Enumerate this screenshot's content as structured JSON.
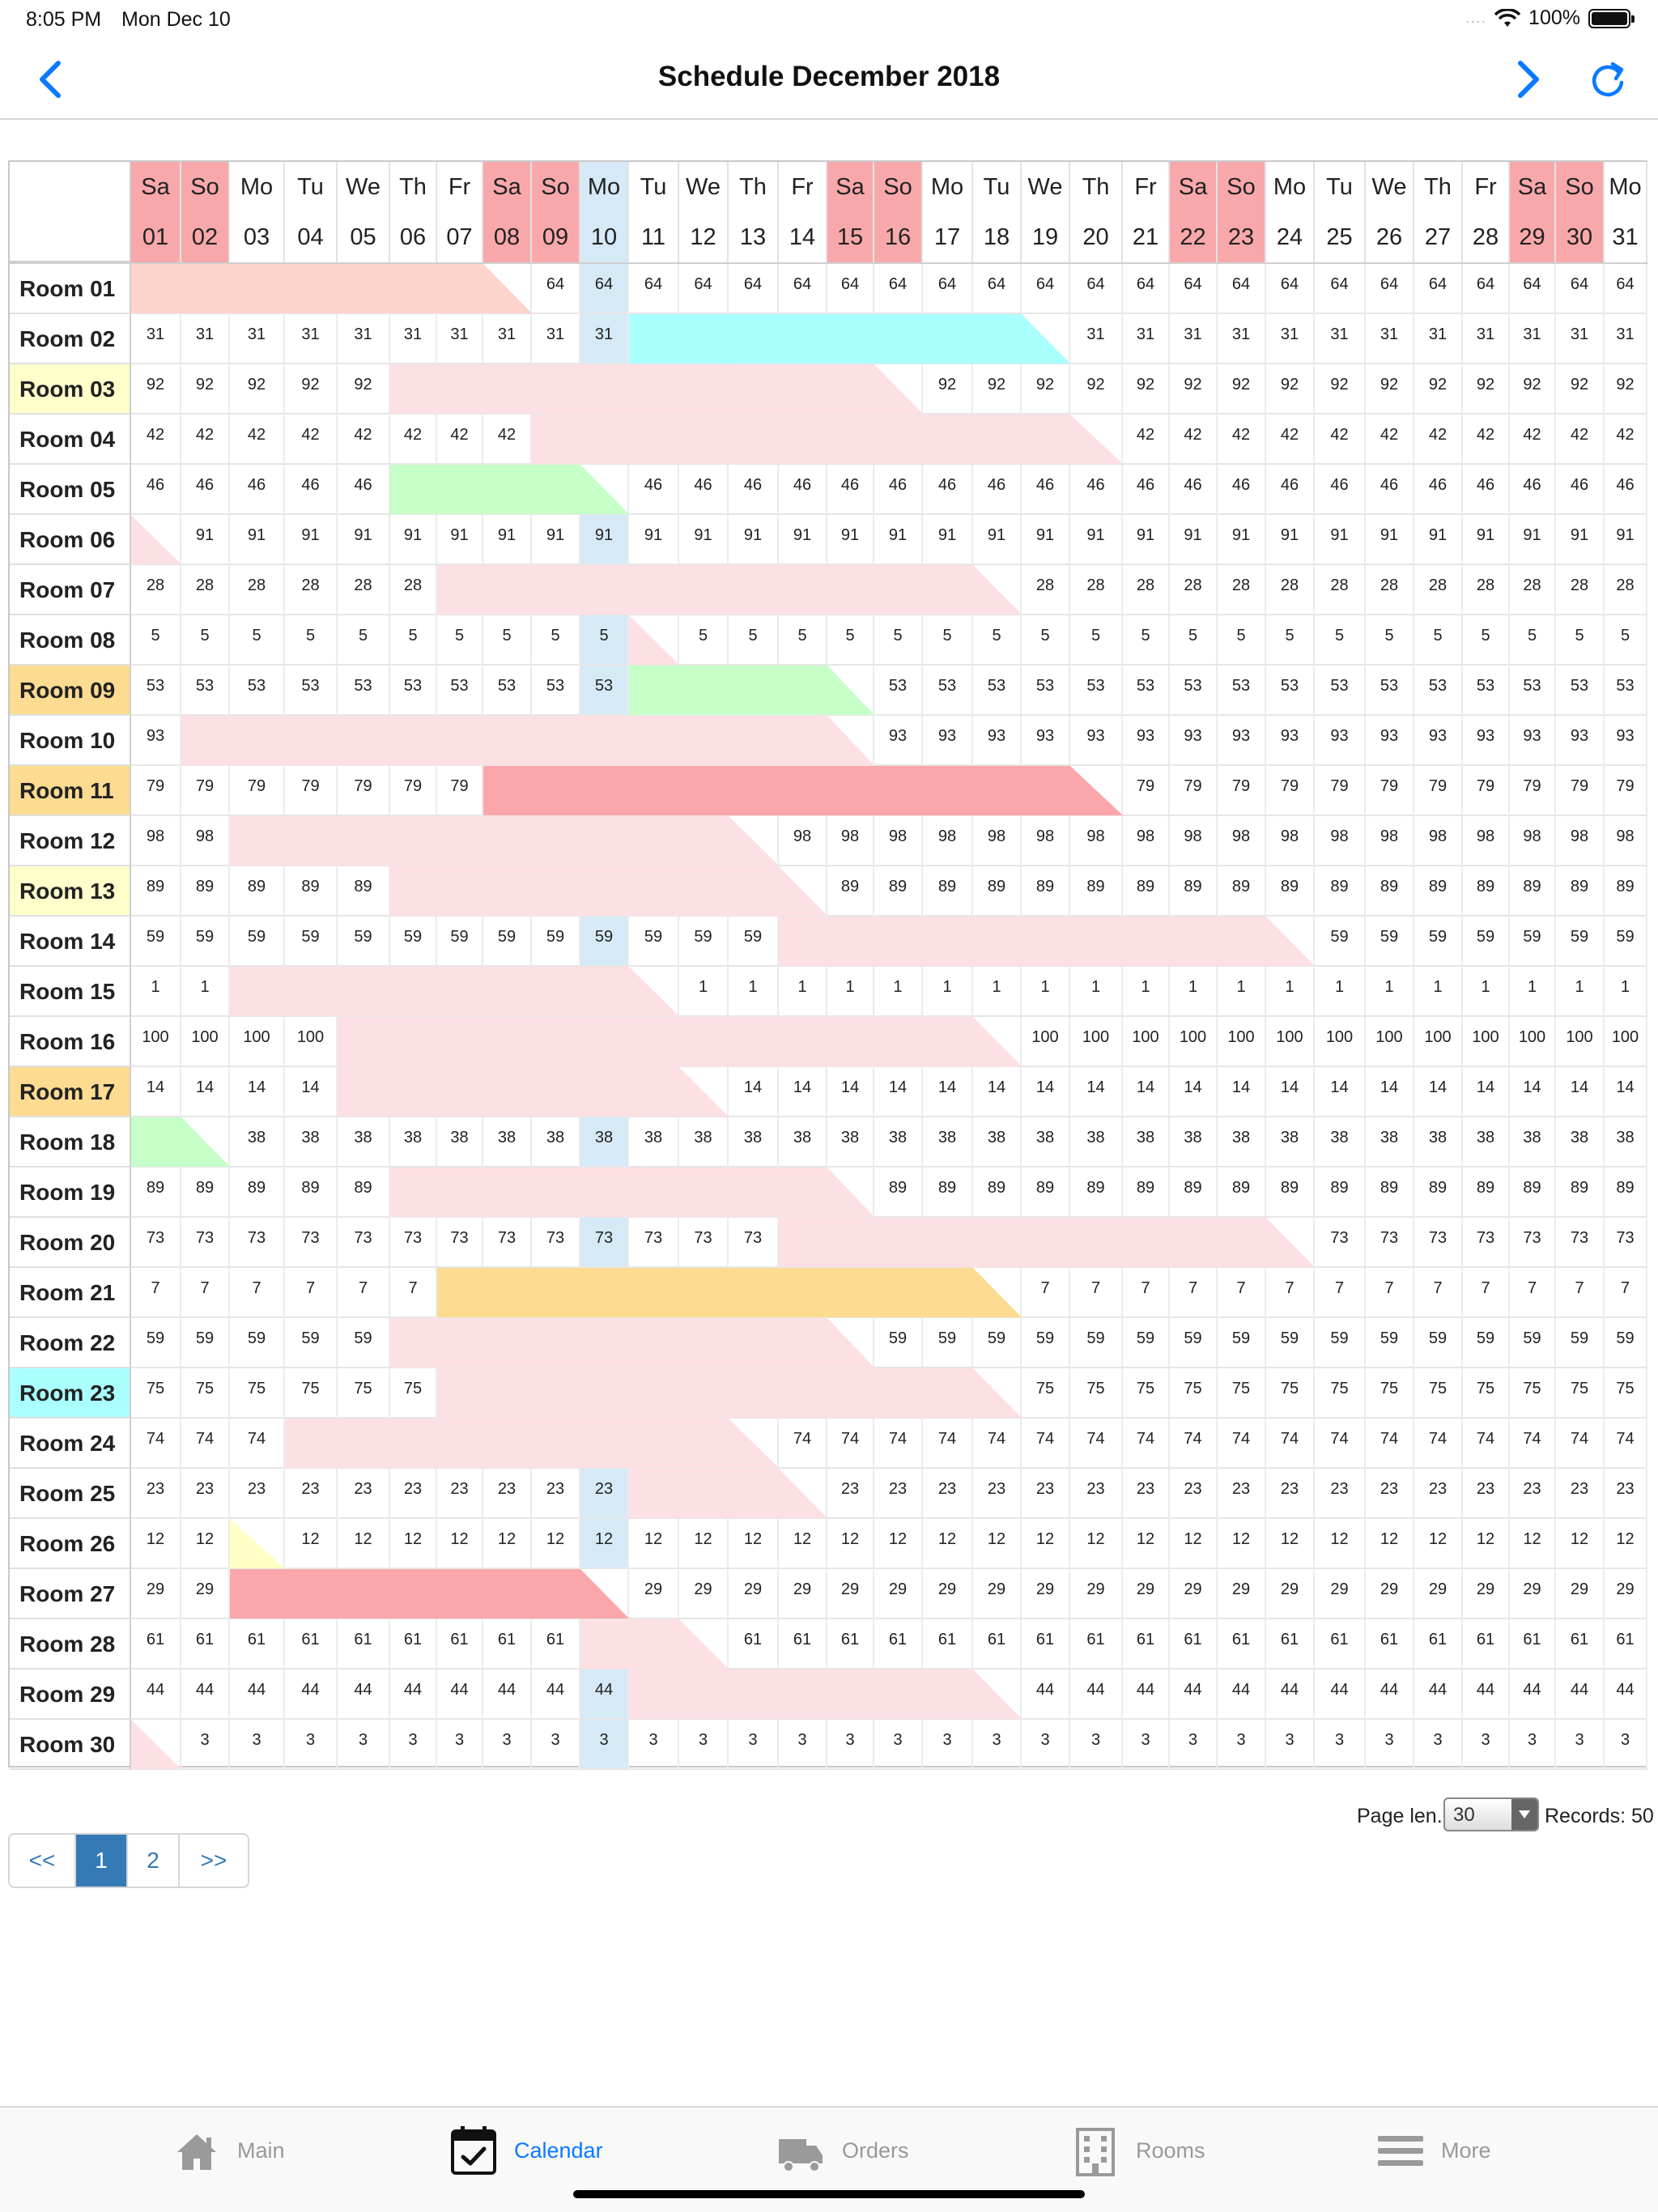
{
  "statusbar": {
    "time": "8:05 PM",
    "date": "Mon Dec 10",
    "dots": "....",
    "battery": "100%"
  },
  "navbar": {
    "title": "Schedule December 2018",
    "prev_icon": "chevron-left-icon",
    "next_icon": "chevron-right-icon",
    "refresh_icon": "refresh-icon"
  },
  "grid": {
    "current_day": "10",
    "days": [
      {
        "dn": "Sa",
        "d": "01",
        "we": true
      },
      {
        "dn": "So",
        "d": "02",
        "we": true
      },
      {
        "dn": "Mo",
        "d": "03"
      },
      {
        "dn": "Tu",
        "d": "04"
      },
      {
        "dn": "We",
        "d": "05"
      },
      {
        "dn": "Th",
        "d": "06"
      },
      {
        "dn": "Fr",
        "d": "07"
      },
      {
        "dn": "Sa",
        "d": "08",
        "we": true
      },
      {
        "dn": "So",
        "d": "09",
        "we": true
      },
      {
        "dn": "Mo",
        "d": "10",
        "cur": true
      },
      {
        "dn": "Tu",
        "d": "11"
      },
      {
        "dn": "We",
        "d": "12"
      },
      {
        "dn": "Th",
        "d": "13"
      },
      {
        "dn": "Fr",
        "d": "14"
      },
      {
        "dn": "Sa",
        "d": "15",
        "we": true
      },
      {
        "dn": "So",
        "d": "16",
        "we": true
      },
      {
        "dn": "Mo",
        "d": "17"
      },
      {
        "dn": "Tu",
        "d": "18"
      },
      {
        "dn": "We",
        "d": "19"
      },
      {
        "dn": "Th",
        "d": "20"
      },
      {
        "dn": "Fr",
        "d": "21"
      },
      {
        "dn": "Sa",
        "d": "22",
        "we": true
      },
      {
        "dn": "So",
        "d": "23",
        "we": true
      },
      {
        "dn": "Mo",
        "d": "24"
      },
      {
        "dn": "Tu",
        "d": "25"
      },
      {
        "dn": "We",
        "d": "26"
      },
      {
        "dn": "Th",
        "d": "27"
      },
      {
        "dn": "Fr",
        "d": "28"
      },
      {
        "dn": "Sa",
        "d": "29",
        "we": true
      },
      {
        "dn": "So",
        "d": "30",
        "we": true
      },
      {
        "dn": "Mo",
        "d": "31"
      }
    ],
    "rooms": [
      {
        "name": "Room 01",
        "value": "64",
        "bookings": [
          {
            "s": 1,
            "e": 8,
            "c": "salmon"
          }
        ]
      },
      {
        "name": "Room 02",
        "value": "31",
        "bookings": [
          {
            "s": 11,
            "e": 19,
            "c": "cyan"
          }
        ]
      },
      {
        "name": "Room 03",
        "value": "92",
        "hl": "yellow",
        "bookings": [
          {
            "s": 6,
            "e": 16,
            "c": "pink"
          }
        ]
      },
      {
        "name": "Room 04",
        "value": "42",
        "bookings": [
          {
            "s": 9,
            "e": 20,
            "c": "pink"
          }
        ]
      },
      {
        "name": "Room 05",
        "value": "46",
        "bookings": [
          {
            "s": 6,
            "e": 10,
            "c": "green"
          }
        ]
      },
      {
        "name": "Room 06",
        "value": "91",
        "bookings": [
          {
            "s": 1,
            "e": 1,
            "c": "pink"
          }
        ]
      },
      {
        "name": "Room 07",
        "value": "28",
        "bookings": [
          {
            "s": 7,
            "e": 18,
            "c": "pink"
          }
        ]
      },
      {
        "name": "Room 08",
        "value": "5",
        "bookings": [
          {
            "s": 11,
            "e": 11,
            "c": "pink"
          }
        ]
      },
      {
        "name": "Room 09",
        "value": "53",
        "hl": "orange",
        "bookings": [
          {
            "s": 11,
            "e": 15,
            "c": "green"
          }
        ]
      },
      {
        "name": "Room 10",
        "value": "93",
        "bookings": [
          {
            "s": 2,
            "e": 15,
            "c": "pink"
          }
        ]
      },
      {
        "name": "Room 11",
        "value": "79",
        "hl": "orange",
        "bookings": [
          {
            "s": 8,
            "e": 20,
            "c": "red"
          }
        ]
      },
      {
        "name": "Room 12",
        "value": "98",
        "bookings": [
          {
            "s": 3,
            "e": 13,
            "c": "pink"
          }
        ]
      },
      {
        "name": "Room 13",
        "value": "89",
        "hl": "yellow",
        "bookings": [
          {
            "s": 6,
            "e": 14,
            "c": "pink"
          }
        ]
      },
      {
        "name": "Room 14",
        "value": "59",
        "bookings": [
          {
            "s": 14,
            "e": 24,
            "c": "pink"
          }
        ]
      },
      {
        "name": "Room 15",
        "value": "1",
        "bookings": [
          {
            "s": 3,
            "e": 11,
            "c": "pink"
          }
        ]
      },
      {
        "name": "Room 16",
        "value": "100",
        "bookings": [
          {
            "s": 5,
            "e": 18,
            "c": "pink"
          }
        ]
      },
      {
        "name": "Room 17",
        "value": "14",
        "hl": "orange",
        "bookings": [
          {
            "s": 5,
            "e": 12,
            "c": "pink"
          }
        ]
      },
      {
        "name": "Room 18",
        "value": "38",
        "bookings": [
          {
            "s": 1,
            "e": 2,
            "c": "green"
          }
        ]
      },
      {
        "name": "Room 19",
        "value": "89",
        "bookings": [
          {
            "s": 6,
            "e": 15,
            "c": "pink"
          }
        ]
      },
      {
        "name": "Room 20",
        "value": "73",
        "bookings": [
          {
            "s": 14,
            "e": 24,
            "c": "pink"
          }
        ]
      },
      {
        "name": "Room 21",
        "value": "7",
        "bookings": [
          {
            "s": 7,
            "e": 18,
            "c": "orange"
          }
        ]
      },
      {
        "name": "Room 22",
        "value": "59",
        "bookings": [
          {
            "s": 6,
            "e": 15,
            "c": "pink"
          }
        ]
      },
      {
        "name": "Room 23",
        "value": "75",
        "hl": "cyan",
        "bookings": [
          {
            "s": 7,
            "e": 18,
            "c": "pink"
          }
        ]
      },
      {
        "name": "Room 24",
        "value": "74",
        "bookings": [
          {
            "s": 4,
            "e": 13,
            "c": "pink"
          }
        ]
      },
      {
        "name": "Room 25",
        "value": "23",
        "bookings": [
          {
            "s": 11,
            "e": 14,
            "c": "pink"
          }
        ]
      },
      {
        "name": "Room 26",
        "value": "12",
        "bookings": [
          {
            "s": 3,
            "e": 3,
            "c": "yellow"
          }
        ]
      },
      {
        "name": "Room 27",
        "value": "29",
        "bookings": [
          {
            "s": 3,
            "e": 10,
            "c": "red"
          }
        ]
      },
      {
        "name": "Room 28",
        "value": "61",
        "bookings": [
          {
            "s": 10,
            "e": 12,
            "c": "pink"
          }
        ]
      },
      {
        "name": "Room 29",
        "value": "44",
        "bookings": [
          {
            "s": 11,
            "e": 18,
            "c": "pink"
          }
        ]
      },
      {
        "name": "Room 30",
        "value": "3",
        "bookings": [
          {
            "s": 1,
            "e": 1,
            "c": "pink"
          }
        ]
      }
    ]
  },
  "pagination": {
    "page_len_label": "Page len.",
    "page_len_value": "30",
    "records_label": "Records: 50",
    "pages": [
      "<<",
      "1",
      "2",
      ">>"
    ],
    "active_page": "1"
  },
  "tabbar": {
    "tabs": [
      {
        "label": "Main",
        "icon": "home-icon"
      },
      {
        "label": "Calendar",
        "icon": "calendar-icon",
        "active": true
      },
      {
        "label": "Orders",
        "icon": "truck-icon"
      },
      {
        "label": "Rooms",
        "icon": "building-icon"
      },
      {
        "label": "More",
        "icon": "menu-icon"
      }
    ]
  },
  "colors": {
    "accent": "#0a7aff",
    "weekend": "#f8a8ab",
    "current_day": "#d6e9f6",
    "booking_pink": "#fde0e3",
    "booking_red": "#fba6aa",
    "booking_green": "#c6ffc7",
    "booking_cyan": "#aaffff",
    "booking_yellow": "#ffffc6",
    "booking_orange": "#fddb91",
    "booking_salmon": "#fdd4cc",
    "pager_active": "#337ab7"
  }
}
